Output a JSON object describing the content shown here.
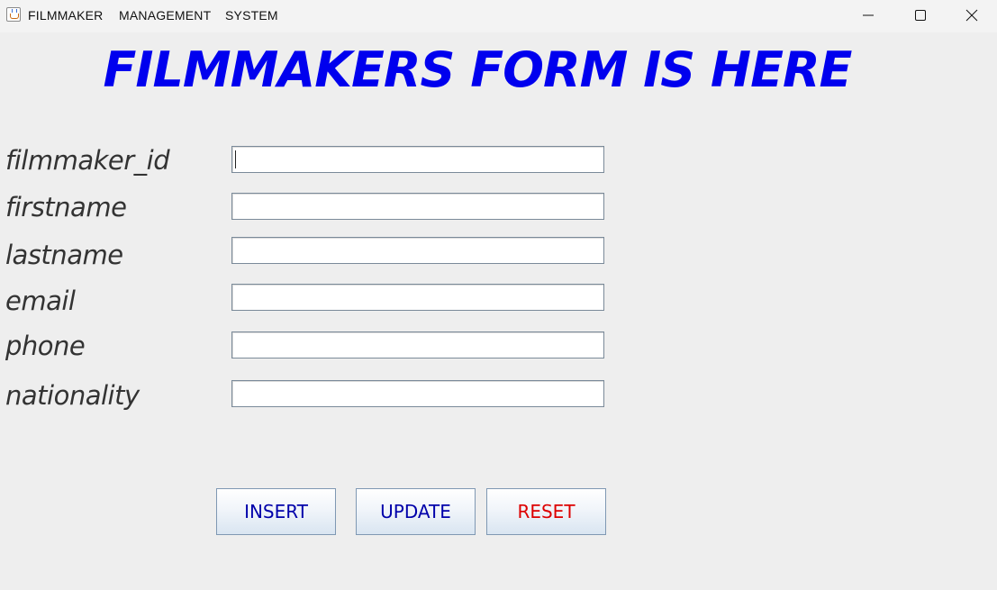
{
  "titlebar": {
    "menu": [
      "FILMMAKER",
      "MANAGEMENT",
      "SYSTEM"
    ],
    "icons": [
      "java-app-icon",
      "minimize-icon",
      "maximize-icon",
      "close-icon"
    ]
  },
  "form": {
    "title": "FILMMAKERS FORM IS HERE",
    "title_color": "#0000EE",
    "fields": [
      {
        "label": "filmmaker_id",
        "value": ""
      },
      {
        "label": "firstname",
        "value": ""
      },
      {
        "label": "lastname",
        "value": ""
      },
      {
        "label": "email",
        "value": ""
      },
      {
        "label": "phone",
        "value": ""
      },
      {
        "label": "nationality",
        "value": ""
      }
    ],
    "buttons": {
      "insert": {
        "label": "INSERT",
        "color": "#0000AA"
      },
      "update": {
        "label": "UPDATE",
        "color": "#0000AA"
      },
      "reset": {
        "label": "RESET",
        "color": "#DD0000"
      }
    }
  }
}
